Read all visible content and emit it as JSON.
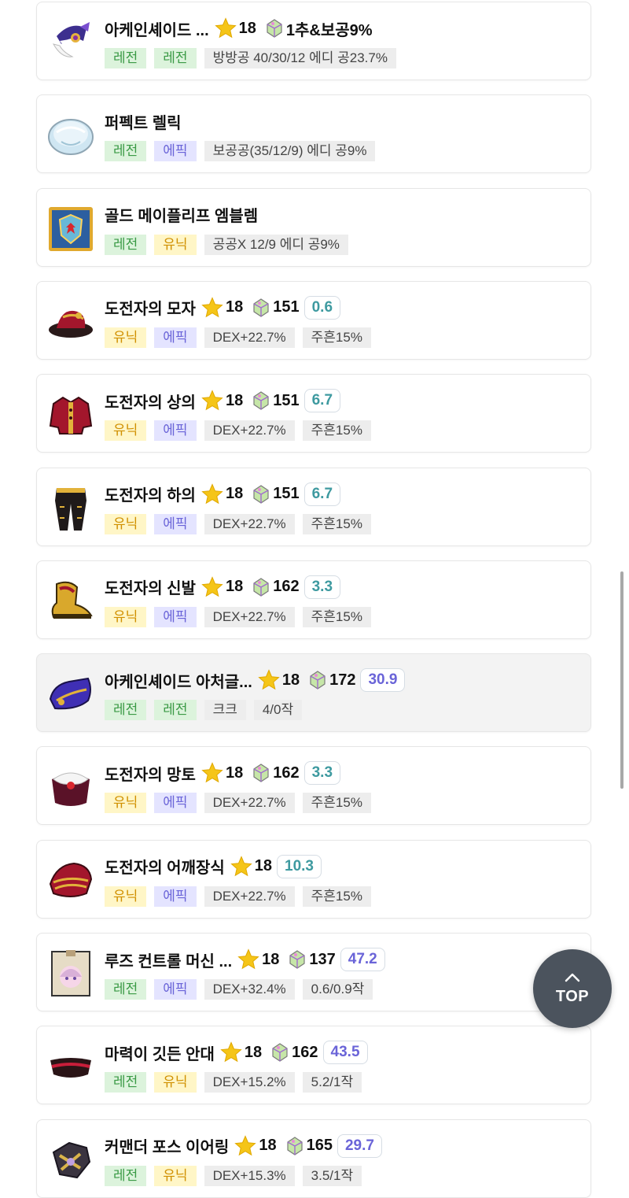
{
  "colors": {
    "legendary": "#3a9a45",
    "unique": "#d09000",
    "epic": "#6a64d8",
    "score_teal": "#3e9aa0",
    "score_purple": "#6a64d8",
    "top_button": "#4b535d"
  },
  "items": [
    {
      "icon": "arcane-hat-icon",
      "name": "아케인셰이드 ...",
      "starforce": "18",
      "pot": "1추&보공9%",
      "score": null,
      "score_color": null,
      "highlight": false,
      "tags": [
        {
          "text": "레전",
          "type": "legend"
        },
        {
          "text": "레전",
          "type": "legend"
        },
        {
          "text": "방방공 40/30/12 에디 공23.7%",
          "type": "gray"
        }
      ]
    },
    {
      "icon": "relic-icon",
      "name": "퍼펙트 렐릭",
      "starforce": null,
      "pot": null,
      "score": null,
      "score_color": null,
      "highlight": false,
      "tags": [
        {
          "text": "레전",
          "type": "legend"
        },
        {
          "text": "에픽",
          "type": "epic"
        },
        {
          "text": "보공공(35/12/9) 에디 공9%",
          "type": "gray"
        }
      ]
    },
    {
      "icon": "emblem-icon",
      "name": "골드 메이플리프 엠블렘",
      "starforce": null,
      "pot": null,
      "score": null,
      "score_color": null,
      "highlight": false,
      "tags": [
        {
          "text": "레전",
          "type": "legend"
        },
        {
          "text": "유닉",
          "type": "unique"
        },
        {
          "text": "공공X 12/9 에디 공9%",
          "type": "gray"
        }
      ]
    },
    {
      "icon": "challenger-hat-icon",
      "name": "도전자의 모자",
      "starforce": "18",
      "pot": "151",
      "score": "0.6",
      "score_color": "teal",
      "highlight": false,
      "tags": [
        {
          "text": "유닉",
          "type": "unique"
        },
        {
          "text": "에픽",
          "type": "epic"
        },
        {
          "text": "DEX+22.7%",
          "type": "gray"
        },
        {
          "text": "주흔15%",
          "type": "gray"
        }
      ]
    },
    {
      "icon": "challenger-top-icon",
      "name": "도전자의 상의",
      "starforce": "18",
      "pot": "151",
      "score": "6.7",
      "score_color": "teal",
      "highlight": false,
      "tags": [
        {
          "text": "유닉",
          "type": "unique"
        },
        {
          "text": "에픽",
          "type": "epic"
        },
        {
          "text": "DEX+22.7%",
          "type": "gray"
        },
        {
          "text": "주흔15%",
          "type": "gray"
        }
      ]
    },
    {
      "icon": "challenger-pants-icon",
      "name": "도전자의 하의",
      "starforce": "18",
      "pot": "151",
      "score": "6.7",
      "score_color": "teal",
      "highlight": false,
      "tags": [
        {
          "text": "유닉",
          "type": "unique"
        },
        {
          "text": "에픽",
          "type": "epic"
        },
        {
          "text": "DEX+22.7%",
          "type": "gray"
        },
        {
          "text": "주흔15%",
          "type": "gray"
        }
      ]
    },
    {
      "icon": "challenger-shoes-icon",
      "name": "도전자의 신발",
      "starforce": "18",
      "pot": "162",
      "score": "3.3",
      "score_color": "teal",
      "highlight": false,
      "tags": [
        {
          "text": "유닉",
          "type": "unique"
        },
        {
          "text": "에픽",
          "type": "epic"
        },
        {
          "text": "DEX+22.7%",
          "type": "gray"
        },
        {
          "text": "주흔15%",
          "type": "gray"
        }
      ]
    },
    {
      "icon": "arcane-glove-icon",
      "name": "아케인셰이드 아처글...",
      "starforce": "18",
      "pot": "172",
      "score": "30.9",
      "score_color": "purple",
      "highlight": true,
      "tags": [
        {
          "text": "레전",
          "type": "legend"
        },
        {
          "text": "레전",
          "type": "legend"
        },
        {
          "text": "크크",
          "type": "gray"
        },
        {
          "text": "4/0작",
          "type": "gray"
        }
      ]
    },
    {
      "icon": "challenger-cape-icon",
      "name": "도전자의 망토",
      "starforce": "18",
      "pot": "162",
      "score": "3.3",
      "score_color": "teal",
      "highlight": false,
      "tags": [
        {
          "text": "유닉",
          "type": "unique"
        },
        {
          "text": "에픽",
          "type": "epic"
        },
        {
          "text": "DEX+22.7%",
          "type": "gray"
        },
        {
          "text": "주흔15%",
          "type": "gray"
        }
      ]
    },
    {
      "icon": "challenger-shoulder-icon",
      "name": "도전자의 어깨장식",
      "starforce": "18",
      "pot": null,
      "score": "10.3",
      "score_color": "teal",
      "highlight": false,
      "tags": [
        {
          "text": "유닉",
          "type": "unique"
        },
        {
          "text": "에픽",
          "type": "epic"
        },
        {
          "text": "DEX+22.7%",
          "type": "gray"
        },
        {
          "text": "주흔15%",
          "type": "gray"
        }
      ]
    },
    {
      "icon": "lucid-machine-icon",
      "name": "루즈 컨트롤 머신 ...",
      "starforce": "18",
      "pot": "137",
      "score": "47.2",
      "score_color": "purple",
      "highlight": false,
      "tags": [
        {
          "text": "레전",
          "type": "legend"
        },
        {
          "text": "에픽",
          "type": "epic"
        },
        {
          "text": "DEX+32.4%",
          "type": "gray"
        },
        {
          "text": "0.6/0.9작",
          "type": "gray"
        }
      ]
    },
    {
      "icon": "eyepatch-icon",
      "name": "마력이 깃든 안대",
      "starforce": "18",
      "pot": "162",
      "score": "43.5",
      "score_color": "purple",
      "highlight": false,
      "tags": [
        {
          "text": "레전",
          "type": "legend"
        },
        {
          "text": "유닉",
          "type": "unique"
        },
        {
          "text": "DEX+15.2%",
          "type": "gray"
        },
        {
          "text": "5.2/1작",
          "type": "gray"
        }
      ]
    },
    {
      "icon": "earring-icon",
      "name": "커맨더 포스 이어링",
      "starforce": "18",
      "pot": "165",
      "score": "29.7",
      "score_color": "purple",
      "highlight": false,
      "tags": [
        {
          "text": "레전",
          "type": "legend"
        },
        {
          "text": "유닉",
          "type": "unique"
        },
        {
          "text": "DEX+15.3%",
          "type": "gray"
        },
        {
          "text": "3.5/1작",
          "type": "gray"
        }
      ]
    }
  ],
  "top_button": {
    "label": "TOP",
    "icon": "chevron-up-icon"
  }
}
